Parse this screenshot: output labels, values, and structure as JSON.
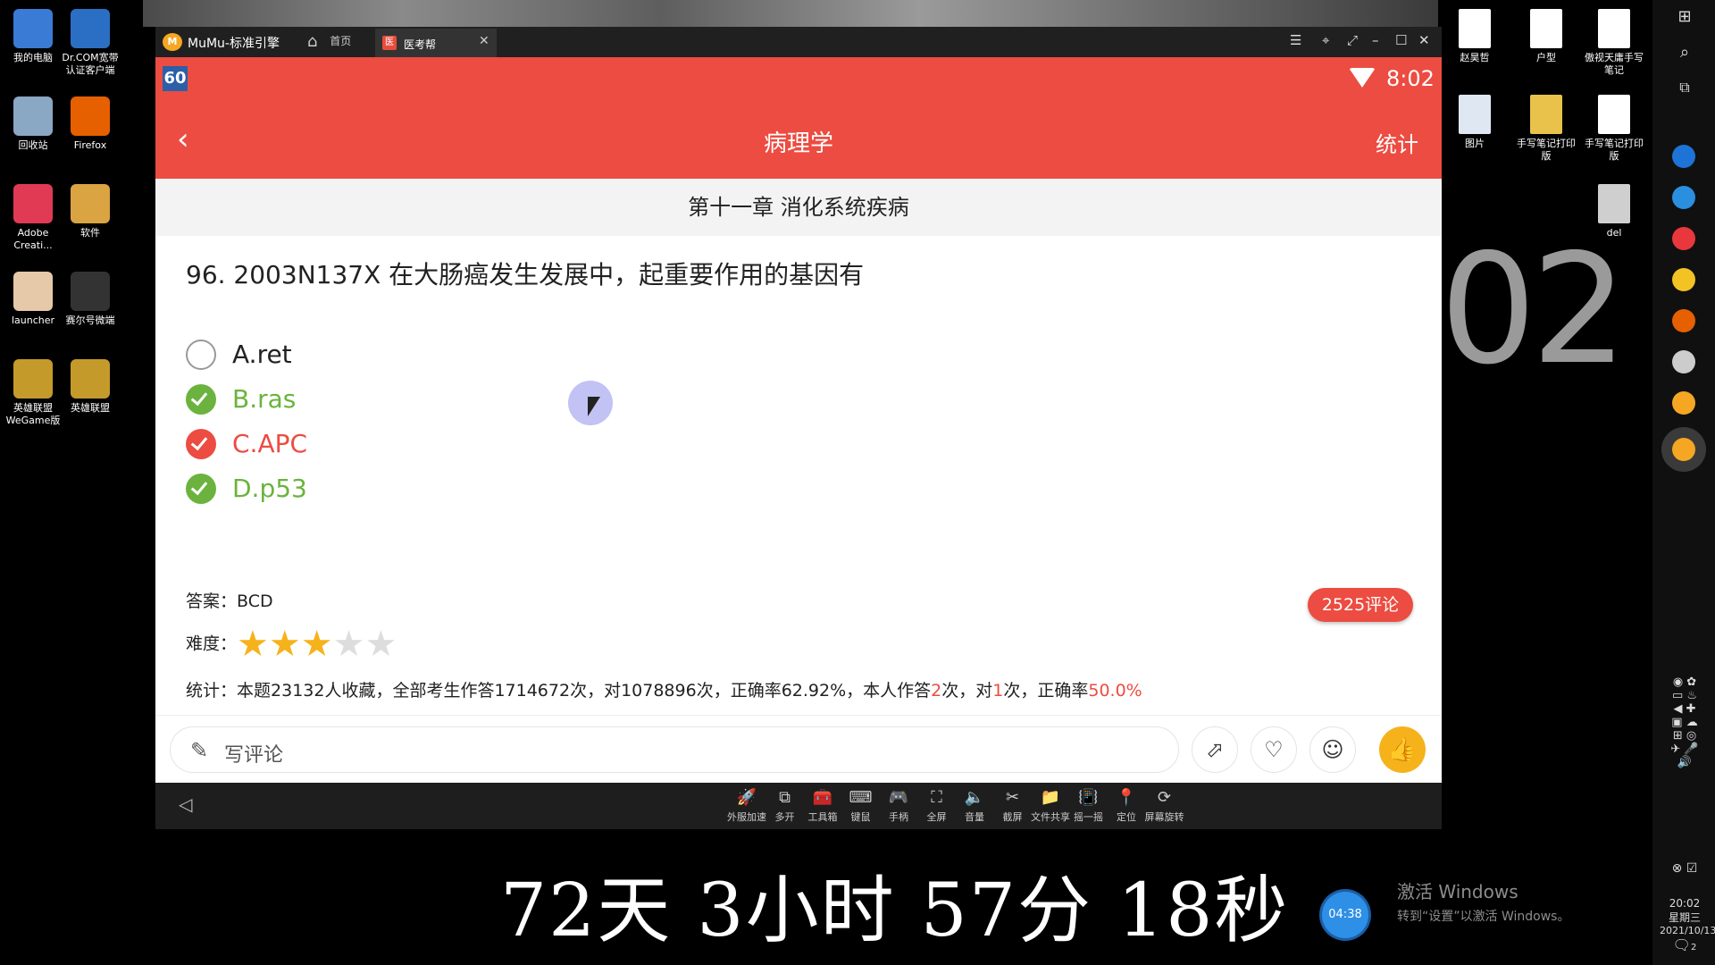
{
  "desktop": {
    "left_icons": [
      {
        "label": "我的电脑",
        "color": "#3a7bd5"
      },
      {
        "label": "Dr.COM宽带认证客户端",
        "color": "#2b6fc4"
      },
      {
        "label": "回收站",
        "color": "#8aa7c4"
      },
      {
        "label": "Firefox",
        "color": "#e66000"
      },
      {
        "label": "Adobe Creati...",
        "color": "#e13a55"
      },
      {
        "label": "软件",
        "color": "#d9a441"
      },
      {
        "label": "launcher",
        "color": "#e6c9a8"
      },
      {
        "label": "赛尔号微端",
        "color": "#333333"
      },
      {
        "label": "英雄联盟WeGame版",
        "color": "#c49a2b"
      },
      {
        "label": "英雄联盟",
        "color": "#c49a2b"
      }
    ],
    "right_icons": [
      {
        "label": "赵昊哲",
        "color": "#ffffff"
      },
      {
        "label": "户型",
        "color": "#ffffff"
      },
      {
        "label": "傲视天庸手写笔记",
        "color": "#ffffff"
      },
      {
        "label": "图片",
        "color": "#dfe8f2"
      },
      {
        "label": "手写笔记打印版",
        "color": "#e8c24a"
      },
      {
        "label": "手写笔记打印版",
        "color": "#ffffff"
      },
      {
        "label": "del",
        "color": "#cfcfcf"
      }
    ],
    "big_clock_fragment": "02"
  },
  "emulator": {
    "title": "MuMu-标准引擎",
    "home_label": "首页",
    "tab_label": "医考帮",
    "tab_icon": "医",
    "toolbar": [
      {
        "label": "外服加速",
        "icon": "🚀"
      },
      {
        "label": "多开",
        "icon": "⧉"
      },
      {
        "label": "工具箱",
        "icon": "🧰"
      },
      {
        "label": "键鼠",
        "icon": "⌨"
      },
      {
        "label": "手柄",
        "icon": "🎮"
      },
      {
        "label": "全屏",
        "icon": "⛶"
      },
      {
        "label": "音量",
        "icon": "🔈"
      },
      {
        "label": "截屏",
        "icon": "✂"
      },
      {
        "label": "文件共享",
        "icon": "📁"
      },
      {
        "label": "摇一摇",
        "icon": "📳"
      },
      {
        "label": "定位",
        "icon": "📍"
      },
      {
        "label": "屏幕旋转",
        "icon": "⟳"
      }
    ]
  },
  "android": {
    "status": {
      "badge": "60",
      "time": "8:02"
    },
    "appbar": {
      "back": "‹",
      "title": "病理学",
      "stats_label": "统计"
    },
    "chapter": "第十一章 消化系统疾病",
    "question": "96. 2003N137X 在大肠癌发生发展中，起重要作用的基因有",
    "options": [
      {
        "text": "A.ret",
        "state": "unselected",
        "color": "#222222"
      },
      {
        "text": "B.ras",
        "state": "correct",
        "color": "#6bb33e"
      },
      {
        "text": "C.APC",
        "state": "wrong",
        "color": "#ec4c41"
      },
      {
        "text": "D.p53",
        "state": "correct",
        "color": "#6bb33e"
      }
    ],
    "answer_label": "答案：",
    "answer": "BCD",
    "difficulty_label": "难度：",
    "difficulty_stars": 3,
    "difficulty_max": 5,
    "stats_label": "统计：",
    "stats_main": "本题23132人收藏，全部考生作答1714672次，对1078896次，正确率62.92%，本人作答",
    "stats_my_answers": "2",
    "stats_mid1": "次，对",
    "stats_my_correct": "1",
    "stats_mid2": "次，正确率",
    "stats_my_rate": "50.0%",
    "comments_badge": "2525评论",
    "comment_placeholder": "写评论",
    "colors": {
      "accent": "#ec4c41",
      "correct": "#6bb33e",
      "star": "#f6b21b"
    }
  },
  "overlay": {
    "countdown": "72天  3小时  57分  18秒",
    "clock_bubble": "04:38",
    "activate_line1": "激活 Windows",
    "activate_line2": "转到“设置”以激活 Windows。"
  },
  "taskbar": {
    "time": "20:02",
    "weekday": "星期三",
    "date": "2021/10/13",
    "notification_count": "2"
  }
}
